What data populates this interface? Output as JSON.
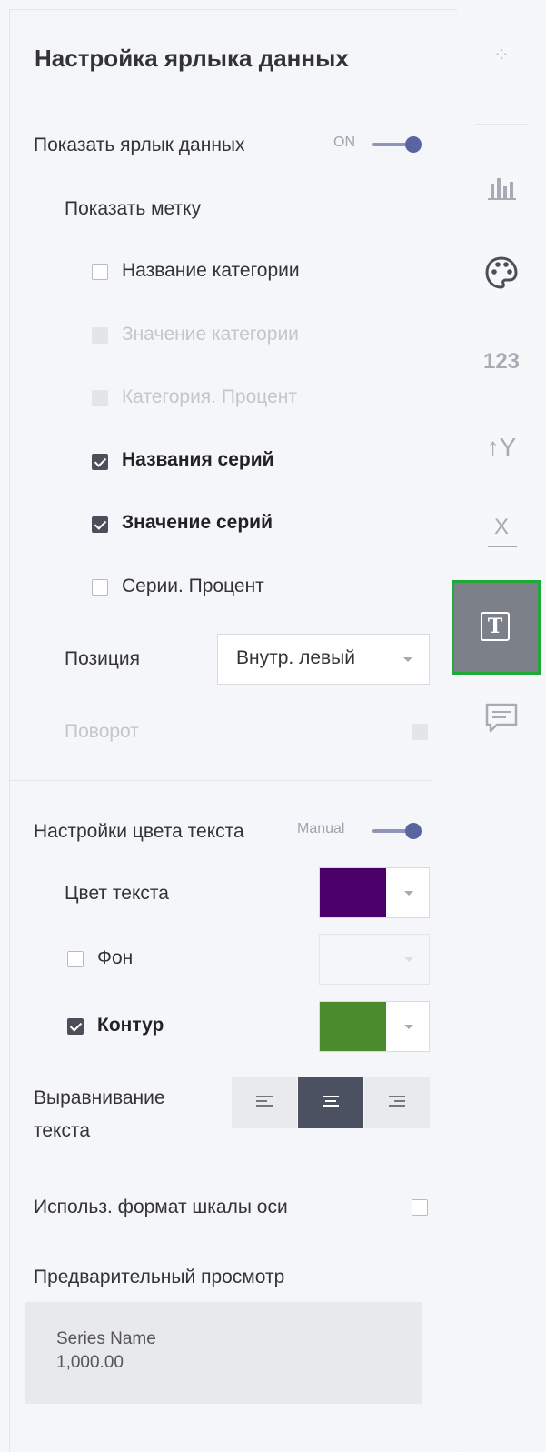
{
  "panel": {
    "title": "Настройка ярлыка данных",
    "show_label": {
      "label": "Показать ярлык данных",
      "toggle_text": "ON",
      "on": true
    },
    "show_mark": "Показать метку",
    "options": [
      {
        "label": "Название категории",
        "checked": false,
        "disabled": false
      },
      {
        "label": "Значение категории",
        "checked": false,
        "disabled": true
      },
      {
        "label": "Категория. Процент",
        "checked": false,
        "disabled": true
      },
      {
        "label": "Названия серий",
        "checked": true,
        "disabled": false
      },
      {
        "label": "Значение серий",
        "checked": true,
        "disabled": false
      },
      {
        "label": "Серии. Процент",
        "checked": false,
        "disabled": false
      }
    ],
    "position": {
      "label": "Позиция",
      "value": "Внутр. левый"
    },
    "rotation": {
      "label": "Поворот",
      "disabled": true
    },
    "text_color_settings": {
      "label": "Настройки цвета текста",
      "toggle_text": "Manual",
      "on": true
    },
    "text_color": {
      "label": "Цвет текста",
      "color": "#4a0068"
    },
    "background": {
      "label": "Фон",
      "checked": false,
      "color": "#f5f6f9"
    },
    "outline": {
      "label": "Контур",
      "checked": true,
      "color": "#4b8b2e"
    },
    "alignment": {
      "label_line1": "Выравнивание",
      "label_line2": "текста",
      "options": [
        "left",
        "center",
        "right"
      ],
      "selected": "center"
    },
    "axis_format": {
      "label": "Использ. формат шкалы оси",
      "checked": false
    },
    "preview": {
      "label": "Предварительный просмотр",
      "line1": "Series Name",
      "line2": "1,000.00"
    }
  },
  "rail": {
    "items": [
      {
        "name": "scatter-icon",
        "text": "⁘"
      },
      {
        "name": "bar-chart-icon",
        "text": ""
      },
      {
        "name": "palette-icon",
        "text": ""
      },
      {
        "name": "number-format-icon",
        "text": "123"
      },
      {
        "name": "y-axis-icon",
        "text": "↑Y"
      },
      {
        "name": "x-axis-icon",
        "text": "X"
      },
      {
        "name": "text-icon",
        "text": "T"
      },
      {
        "name": "comment-icon",
        "text": ""
      }
    ],
    "active": "text-icon"
  },
  "colors": {
    "accent": "#5a64a0",
    "highlight": "#1fa93b",
    "active_bg": "#7c8089"
  }
}
